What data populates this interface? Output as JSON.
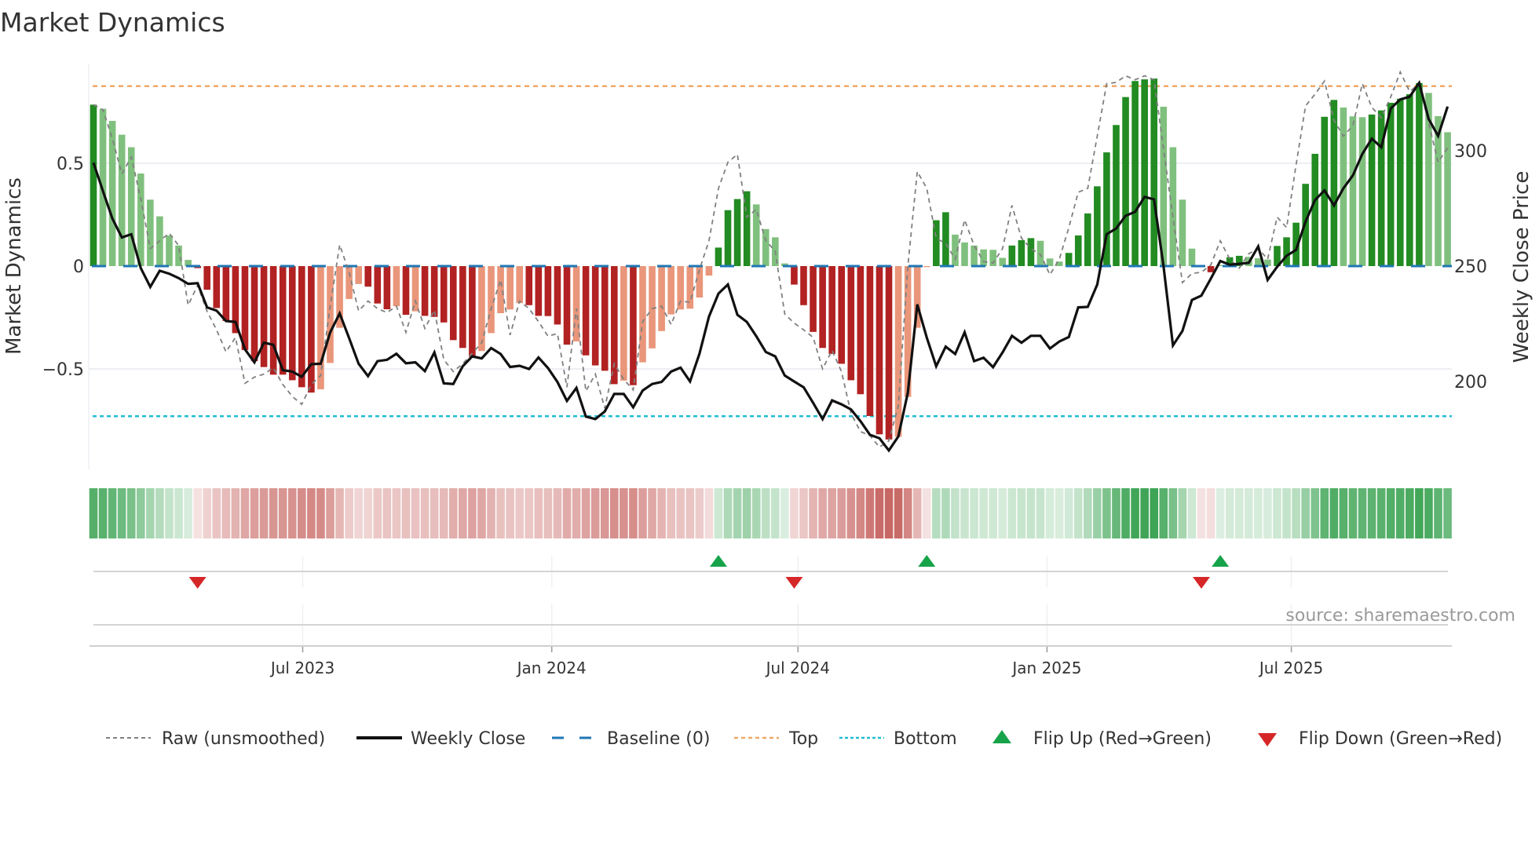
{
  "chart_data": {
    "type": "bar",
    "title": "Market Dynamics",
    "ylabel": "Market Dynamics",
    "y2label": "Weekly Close Price",
    "ylim": [
      -0.98,
      0.98
    ],
    "y2lim": [
      162.5,
      337.5
    ],
    "y_ticks": [
      {
        "value": -0.5,
        "label": "−0.5"
      },
      {
        "value": 0,
        "label": "0"
      },
      {
        "value": 0.5,
        "label": "0.5"
      }
    ],
    "y2_ticks": [
      {
        "value": 200,
        "label": "200"
      },
      {
        "value": 250,
        "label": "250"
      },
      {
        "value": 300,
        "label": "300"
      }
    ],
    "x_ticks": [
      {
        "label": "Jul 2023",
        "week_index": 22.1
      },
      {
        "label": "Jan 2024",
        "week_index": 48.4
      },
      {
        "label": "Jul 2024",
        "week_index": 74.4
      },
      {
        "label": "Jan 2025",
        "week_index": 100.7
      },
      {
        "label": "Jul 2025",
        "week_index": 126.5
      }
    ],
    "top_level": 0.875,
    "bottom_level": -0.73,
    "baseline": 0,
    "bars": {
      "name": "Market Dynamics (smoothed)",
      "values": [
        0.785,
        0.765,
        0.706,
        0.639,
        0.578,
        0.45,
        0.323,
        0.242,
        0.149,
        0.1,
        0.03,
        -0.01,
        -0.115,
        -0.204,
        -0.267,
        -0.326,
        -0.408,
        -0.462,
        -0.491,
        -0.528,
        -0.528,
        -0.555,
        -0.589,
        -0.615,
        -0.599,
        -0.471,
        -0.3,
        -0.16,
        -0.087,
        -0.1,
        -0.182,
        -0.21,
        -0.195,
        -0.237,
        -0.22,
        -0.242,
        -0.247,
        -0.274,
        -0.36,
        -0.398,
        -0.443,
        -0.413,
        -0.326,
        -0.229,
        -0.211,
        -0.18,
        -0.19,
        -0.242,
        -0.243,
        -0.284,
        -0.382,
        -0.366,
        -0.434,
        -0.483,
        -0.509,
        -0.574,
        -0.557,
        -0.579,
        -0.468,
        -0.4,
        -0.316,
        -0.235,
        -0.211,
        -0.207,
        -0.153,
        -0.046,
        0.09,
        0.272,
        0.326,
        0.364,
        0.3,
        0.18,
        0.14,
        0.013,
        -0.09,
        -0.19,
        -0.32,
        -0.398,
        -0.427,
        -0.475,
        -0.555,
        -0.623,
        -0.729,
        -0.818,
        -0.843,
        -0.83,
        -0.636,
        -0.3,
        -0.005,
        0.223,
        0.262,
        0.153,
        0.115,
        0.1,
        0.081,
        0.079,
        0.04,
        0.1,
        0.126,
        0.136,
        0.123,
        0.037,
        0.022,
        0.064,
        0.149,
        0.256,
        0.388,
        0.553,
        0.686,
        0.822,
        0.9,
        0.908,
        0.912,
        0.775,
        0.578,
        0.323,
        0.085,
        -0.005,
        -0.03,
        0.005,
        0.043,
        0.05,
        0.045,
        0.038,
        0.032,
        0.098,
        0.14,
        0.211,
        0.4,
        0.546,
        0.726,
        0.808,
        0.771,
        0.728,
        0.724,
        0.737,
        0.757,
        0.794,
        0.814,
        0.836,
        0.89,
        0.842,
        0.729,
        0.651
      ],
      "strong": [
        1,
        0,
        0,
        0,
        0,
        0,
        0,
        0,
        0,
        0,
        0,
        1,
        1,
        1,
        1,
        1,
        1,
        1,
        1,
        1,
        1,
        1,
        1,
        1,
        0,
        0,
        0,
        0,
        0,
        1,
        1,
        1,
        0,
        1,
        0,
        1,
        1,
        1,
        1,
        1,
        1,
        0,
        0,
        0,
        0,
        0,
        1,
        1,
        1,
        1,
        1,
        0,
        1,
        1,
        1,
        1,
        0,
        1,
        0,
        0,
        0,
        0,
        0,
        0,
        0,
        0,
        1,
        1,
        1,
        1,
        0,
        0,
        0,
        0,
        1,
        1,
        1,
        1,
        1,
        1,
        1,
        1,
        1,
        1,
        1,
        0,
        0,
        0,
        0,
        1,
        1,
        0,
        0,
        0,
        0,
        0,
        0,
        1,
        1,
        1,
        0,
        0,
        0,
        1,
        1,
        1,
        1,
        1,
        1,
        1,
        1,
        1,
        1,
        0,
        0,
        0,
        0,
        0,
        1,
        0,
        1,
        1,
        0,
        0,
        0,
        1,
        1,
        1,
        1,
        1,
        1,
        1,
        0,
        0,
        0,
        1,
        1,
        1,
        1,
        1,
        1,
        0,
        0,
        0
      ]
    },
    "series": [
      {
        "name": "Raw (unsmoothed)",
        "axis": "left",
        "values": [
          0.785,
          0.76,
          0.62,
          0.448,
          0.53,
          0.327,
          0.085,
          0.123,
          0.16,
          0.1,
          -0.19,
          -0.093,
          -0.22,
          -0.31,
          -0.417,
          -0.347,
          -0.57,
          -0.54,
          -0.525,
          -0.494,
          -0.576,
          -0.634,
          -0.672,
          -0.576,
          -0.532,
          -0.195,
          0.104,
          -0.03,
          -0.218,
          -0.17,
          -0.207,
          -0.226,
          -0.195,
          -0.322,
          -0.17,
          -0.303,
          -0.214,
          -0.455,
          -0.513,
          -0.475,
          -0.424,
          -0.373,
          -0.207,
          -0.067,
          -0.335,
          -0.17,
          -0.207,
          -0.27,
          -0.341,
          -0.328,
          -0.589,
          -0.207,
          -0.608,
          -0.525,
          -0.691,
          -0.475,
          -0.551,
          -0.602,
          -0.27,
          -0.207,
          -0.195,
          -0.284,
          -0.17,
          -0.176,
          -0.017,
          0.123,
          0.378,
          0.505,
          0.543,
          0.238,
          0.276,
          0.123,
          0.073,
          -0.233,
          -0.277,
          -0.31,
          -0.347,
          -0.5,
          -0.41,
          -0.513,
          -0.716,
          -0.805,
          -0.824,
          -0.88,
          -0.85,
          -0.678,
          0.0,
          0.46,
          0.378,
          0.136,
          0.11,
          0.034,
          0.225,
          0.1,
          0.022,
          0.015,
          0.085,
          0.295,
          0.136,
          0.085,
          0.057,
          -0.042,
          0.034,
          0.187,
          0.359,
          0.378,
          0.632,
          0.887,
          0.893,
          0.925,
          0.906,
          0.925,
          0.906,
          0.569,
          0.238,
          -0.08,
          -0.036,
          -0.03,
          0.006,
          0.123,
          0.034,
          -0.01,
          0.06,
          0.085,
          0.034,
          0.238,
          0.187,
          0.492,
          0.779,
          0.836,
          0.9,
          0.709,
          0.632,
          0.683,
          0.887,
          0.772,
          0.721,
          0.823,
          0.944,
          0.849,
          0.887,
          0.696,
          0.505,
          0.575
        ]
      },
      {
        "name": "Weekly Close",
        "axis": "right",
        "values": [
          294.8,
          282.5,
          270.6,
          262.4,
          263.8,
          249.1,
          241,
          248,
          246.7,
          244.8,
          242.3,
          242.6,
          232.1,
          230.7,
          226.2,
          225.8,
          213.9,
          208.3,
          216.8,
          215.9,
          204.9,
          204.3,
          202,
          207.5,
          207.7,
          221.3,
          229.5,
          218.8,
          207.7,
          202.3,
          208.8,
          209.4,
          212,
          207.9,
          208.3,
          204.5,
          212.6,
          199.2,
          198.9,
          206.6,
          210.9,
          210,
          214.5,
          211.9,
          206.3,
          206.8,
          205.4,
          210.4,
          205.8,
          199.8,
          191.6,
          197.2,
          184.8,
          183.7,
          187,
          194.6,
          194.6,
          188.8,
          196.1,
          198.9,
          199.8,
          204.3,
          206,
          200,
          212,
          228.1,
          238.1,
          242,
          228.9,
          225.8,
          219.6,
          212.8,
          210.9,
          202.6,
          200,
          197.5,
          190.7,
          183.7,
          191.8,
          190.1,
          187.9,
          182.8,
          176.9,
          175.4,
          170.1,
          176.2,
          195.2,
          233.4,
          219,
          206.6,
          215.1,
          211.9,
          221.3,
          208.8,
          210.3,
          206.2,
          212.6,
          219.8,
          216.8,
          219.8,
          219.8,
          214.3,
          217.3,
          219.3,
          232.1,
          232.3,
          242,
          263.8,
          266.3,
          271.8,
          273.5,
          280,
          278.9,
          250,
          215.6,
          221.9,
          235.3,
          237.2,
          244.6,
          252.2,
          250.6,
          251,
          251.4,
          258.5,
          244,
          249.7,
          254.5,
          257,
          269.3,
          278.6,
          282.8,
          276.3,
          283.7,
          289.3,
          298.6,
          305.2,
          301.5,
          318.3,
          322.2,
          323.4,
          329.4,
          313.7,
          306.4,
          319.1
        ]
      }
    ],
    "flips": {
      "up_week_index": [
        66,
        88,
        119
      ],
      "down_week_index": [
        11,
        74,
        117
      ]
    },
    "legend_position": "bottom",
    "grid": true
  },
  "legend": {
    "raw": "Raw (unsmoothed)",
    "close": "Weekly Close",
    "baseline": "Baseline (0)",
    "top": "Top",
    "bottom": "Bottom",
    "flip_up": "Flip Up (Red→Green)",
    "flip_down": "Flip Down (Green→Red)"
  },
  "source": "source: sharemaestro.com",
  "colors": {
    "strong_green": "#228b22",
    "weak_green": "#80c07e",
    "strong_red": "#b22222",
    "weak_red": "#e9967a",
    "baseline": "#1f77b4",
    "top": "#f0a868",
    "bottom": "#22bcd4",
    "raw": "#808080",
    "close": "#111111",
    "flip_up": "#17a34a",
    "flip_down": "#d62728",
    "heat_green": "#3fa556",
    "heat_red": "#c45e5a"
  }
}
